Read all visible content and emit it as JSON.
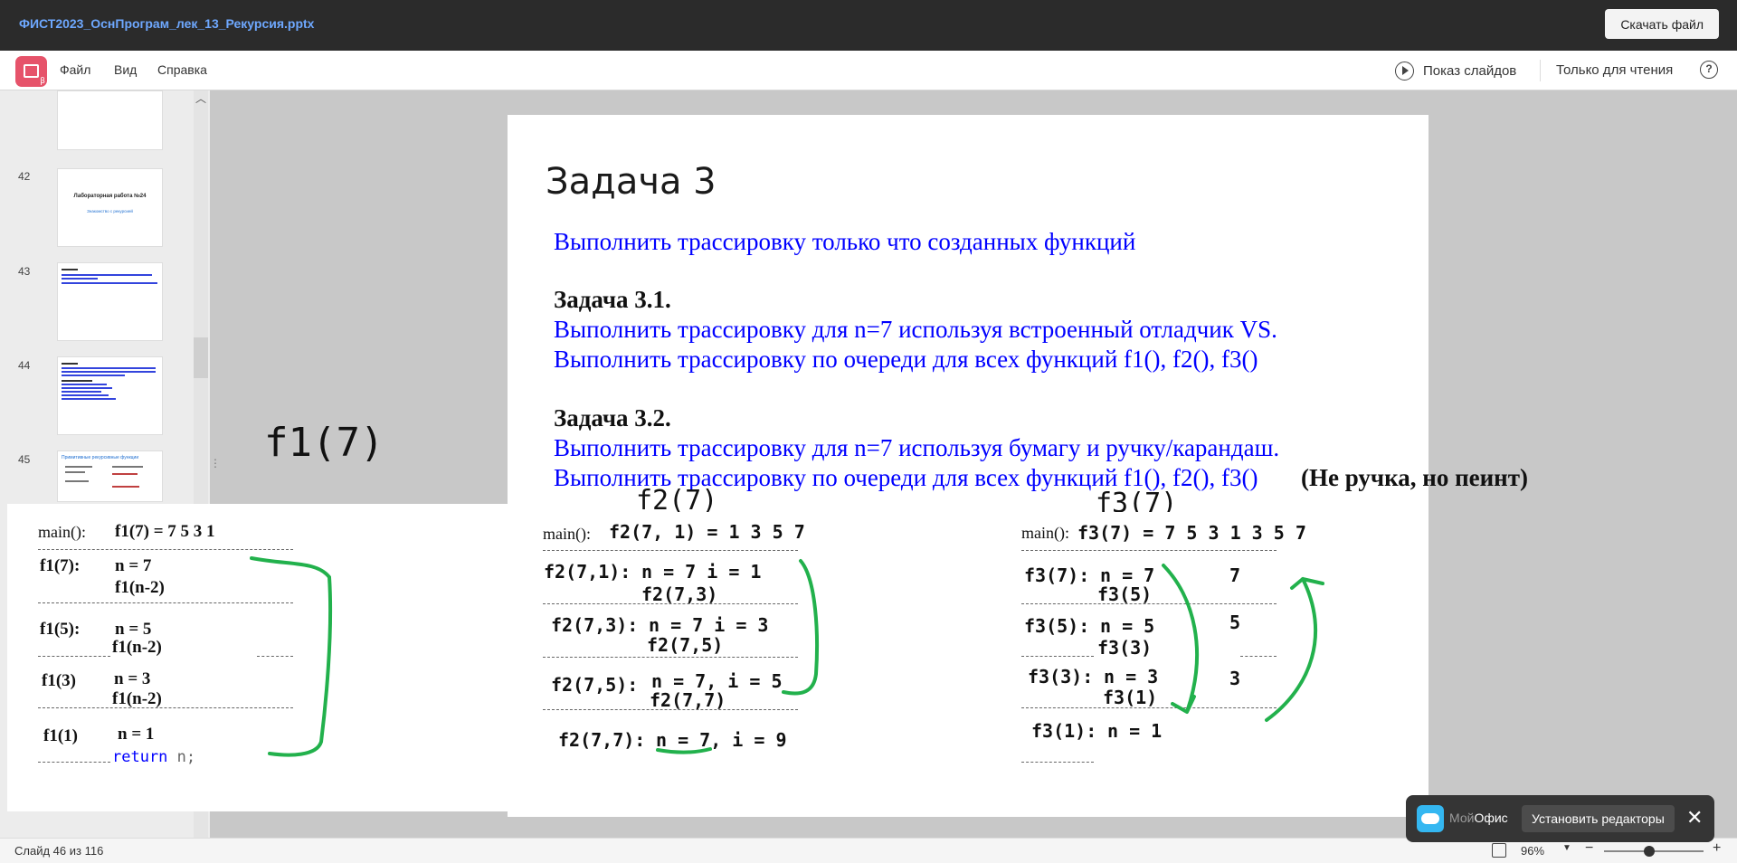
{
  "app": {
    "file_title": "ФИСТ2023_ОснПрограм_лек_13_Рекурсия.pptx",
    "download_label": "Скачать файл"
  },
  "menu": {
    "file": "Файл",
    "view": "Вид",
    "help": "Справка",
    "slideshow": "Показ слайдов",
    "readonly": "Только для чтения",
    "help_icon": "?"
  },
  "thumbnails": [
    {
      "num": "42",
      "title": "Лабораторная работа №24",
      "subtitle": "Знакомство с рекурсией"
    },
    {
      "num": "43"
    },
    {
      "num": "44"
    },
    {
      "num": "45",
      "title": "Примитивные рекурсивные функции"
    }
  ],
  "slide": {
    "title": "Задача 3",
    "intro": "Выполнить трассировку только что созданных функций",
    "t31_head": "Задача 3.1.",
    "t31_l1": "Выполнить трассировку для n=7 используя встроенный отладчик VS.",
    "t31_l2": "Выполнить трассировку по очереди для всех функций f1(), f2(), f3()",
    "t32_head": "Задача 3.2.",
    "t32_l1": "Выполнить трассировку для n=7 используя бумагу и ручку/карандаш.",
    "t32_l2": "Выполнить трассировку по очереди для всех функций f1(), f2(), f3()",
    "t32_note": "(Не ручка, но пеинт)",
    "f1_big": "f1(7)",
    "f2_big": "f2(7)",
    "f3_big": "f3(7)"
  },
  "trace1": {
    "main": "main():",
    "result": "f1(7) = 7 5 3 1",
    "r1_label": "f1(7):",
    "r1_n": "n = 7",
    "r1_call": "f1(n-2)",
    "r2_label": "f1(5):",
    "r2_n": "n = 5",
    "r2_call": "f1(n-2)",
    "r3_label": "f1(3)",
    "r3_n": "n = 3",
    "r3_call": "f1(n-2)",
    "r4_label": "f1(1)",
    "r4_n": "n = 1",
    "return_kw": "return",
    "return_rest": " n;"
  },
  "trace2": {
    "main": "main():",
    "result": "f2(7, 1) = 1 3 5 7",
    "r1_label": "f2(7,1):",
    "r1_vars": "n = 7  i = 1",
    "r1_call": "f2(7,3)",
    "r2_label": "f2(7,3):",
    "r2_vars": "n = 7  i = 3",
    "r2_call": "f2(7,5)",
    "r3_label": "f2(7,5):",
    "r3_vars": "n = 7, i = 5",
    "r3_call": "f2(7,7)",
    "r4_label": "f2(7,7):",
    "r4_vars": "n = 7, i = 9"
  },
  "trace3": {
    "main": "main():",
    "result": "f3(7) = 7 5 3 1 3 5 7",
    "r1_label": "f3(7):",
    "r1_n": "n = 7",
    "r1_call": "f3(5)",
    "r1_out": "7",
    "r2_label": "f3(5):",
    "r2_n": "n = 5",
    "r2_call": "f3(3)",
    "r2_out": "5",
    "r3_label": "f3(3):",
    "r3_n": "n = 3",
    "r3_call": "f3(1)",
    "r3_out": "3",
    "r4_label": "f3(1):",
    "r4_n": "n = 1"
  },
  "status": {
    "slide_counter": "Слайд 46 из 116",
    "zoom": "96%",
    "zoom_fraction": 0.45
  },
  "promo": {
    "brand_prefix": "Мой",
    "brand_suffix": "Офис",
    "install_label": "Установить редакторы",
    "close": "✕"
  },
  "colors": {
    "topbar": "#2b2b2b",
    "title_link": "#6ea8ff",
    "slide_text_blue": "#0000ff",
    "marker_green": "#22b14c"
  }
}
